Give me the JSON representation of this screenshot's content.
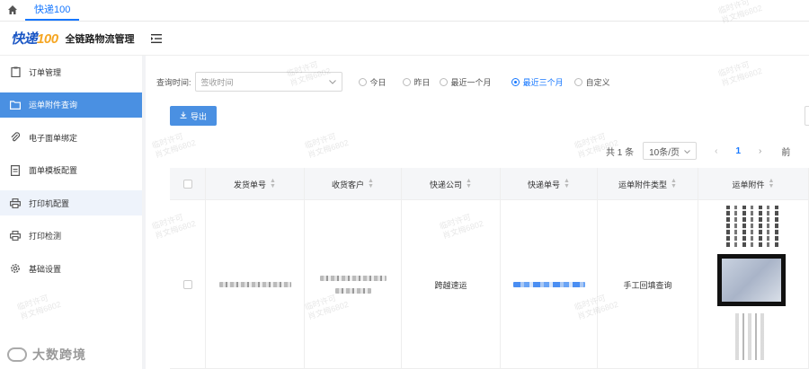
{
  "topbar": {
    "tab_label": "快递100"
  },
  "header": {
    "logo_text": "快递",
    "logo_num": "100",
    "app_title": "全链路物流管理"
  },
  "sidebar": {
    "items": [
      {
        "label": "订单管理",
        "icon": "clipboard-icon"
      },
      {
        "label": "运单附件查询",
        "icon": "folder-icon"
      },
      {
        "label": "电子面单绑定",
        "icon": "paperclip-icon"
      },
      {
        "label": "面单模板配置",
        "icon": "document-icon"
      },
      {
        "label": "打印机配置",
        "icon": "printer-icon"
      },
      {
        "label": "打印检测",
        "icon": "printer-icon"
      },
      {
        "label": "基础设置",
        "icon": "gear-icon"
      }
    ],
    "active_index": 1,
    "bottom_logo": "大数跨境"
  },
  "filter": {
    "label": "查询时间:",
    "select_value": "签收时间",
    "options": [
      "今日",
      "昨日",
      "最近一个月",
      "最近三个月",
      "自定义"
    ],
    "checked": "最近三个月"
  },
  "toolbar": {
    "export_label": "导出"
  },
  "pager": {
    "total_text": "共 1 条",
    "page_size": "10条/页",
    "current_page": "1",
    "tail": "前"
  },
  "table": {
    "columns": [
      "发货单号",
      "收货客户",
      "快递公司",
      "快递单号",
      "运单附件类型",
      "运单附件"
    ],
    "rows": [
      {
        "courier": "跨越速运",
        "attach_type": "手工回填查询"
      }
    ]
  },
  "watermark": {
    "line1": "临时许可",
    "line2": "肖文梅6802"
  },
  "colors": {
    "accent": "#4a90e2",
    "link": "#1677ff"
  }
}
